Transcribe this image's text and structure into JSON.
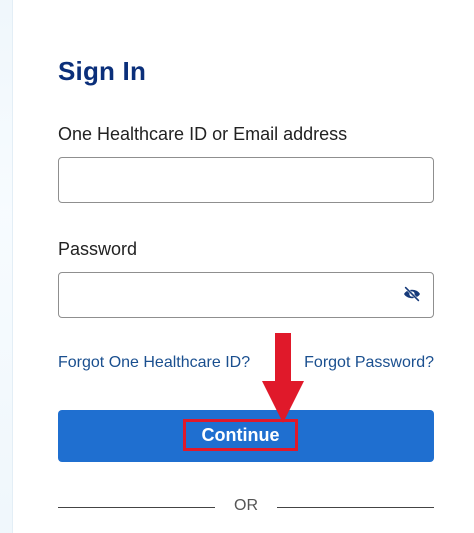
{
  "page": {
    "title": "Sign In"
  },
  "form": {
    "user_label": "One Healthcare ID or Email address",
    "user_value": "",
    "password_label": "Password",
    "password_value": "",
    "toggle_icon": "eye-slash-icon"
  },
  "links": {
    "forgot_id": "Forgot One Healthcare ID?",
    "forgot_password": "Forgot Password?"
  },
  "actions": {
    "continue_label": "Continue"
  },
  "divider": {
    "or_text": "OR"
  },
  "annotation": {
    "arrow_icon": "down-arrow-icon",
    "highlight_color": "#e0192a"
  },
  "colors": {
    "title": "#0b2f7a",
    "primary_button": "#1f6fd0",
    "link": "#1a4f8f"
  }
}
